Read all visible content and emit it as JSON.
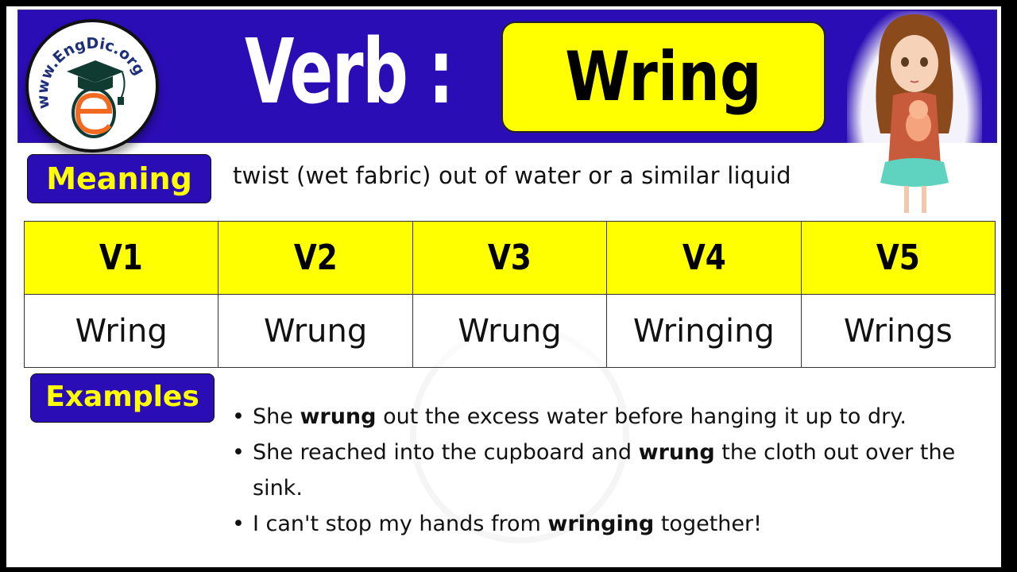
{
  "header": {
    "logo_text": "www.EngDic.org",
    "title_prefix": "Verb :",
    "word": "Wring"
  },
  "meaning": {
    "label": "Meaning",
    "text": "twist (wet fabric) out of water or a similar liquid"
  },
  "forms_table": {
    "headers": [
      "V1",
      "V2",
      "V3",
      "V4",
      "V5"
    ],
    "values": [
      "Wring",
      "Wrung",
      "Wrung",
      "Wringing",
      "Wrings"
    ]
  },
  "examples": {
    "label": "Examples",
    "items": [
      {
        "before": "She ",
        "bold": "wrung",
        "after": " out the excess water before hanging it up to dry."
      },
      {
        "before": "She reached into the cupboard and ",
        "bold": "wrung",
        "after": " the cloth out over the sink."
      },
      {
        "before": "I can't stop my hands from ",
        "bold": "wringing",
        "after": " together!"
      }
    ]
  },
  "colors": {
    "banner_blue": "#2b0db5",
    "highlight_yellow": "#ffff00",
    "frame": "#000000",
    "logo_orange": "#f26a21",
    "logo_green": "#0f3b33"
  }
}
